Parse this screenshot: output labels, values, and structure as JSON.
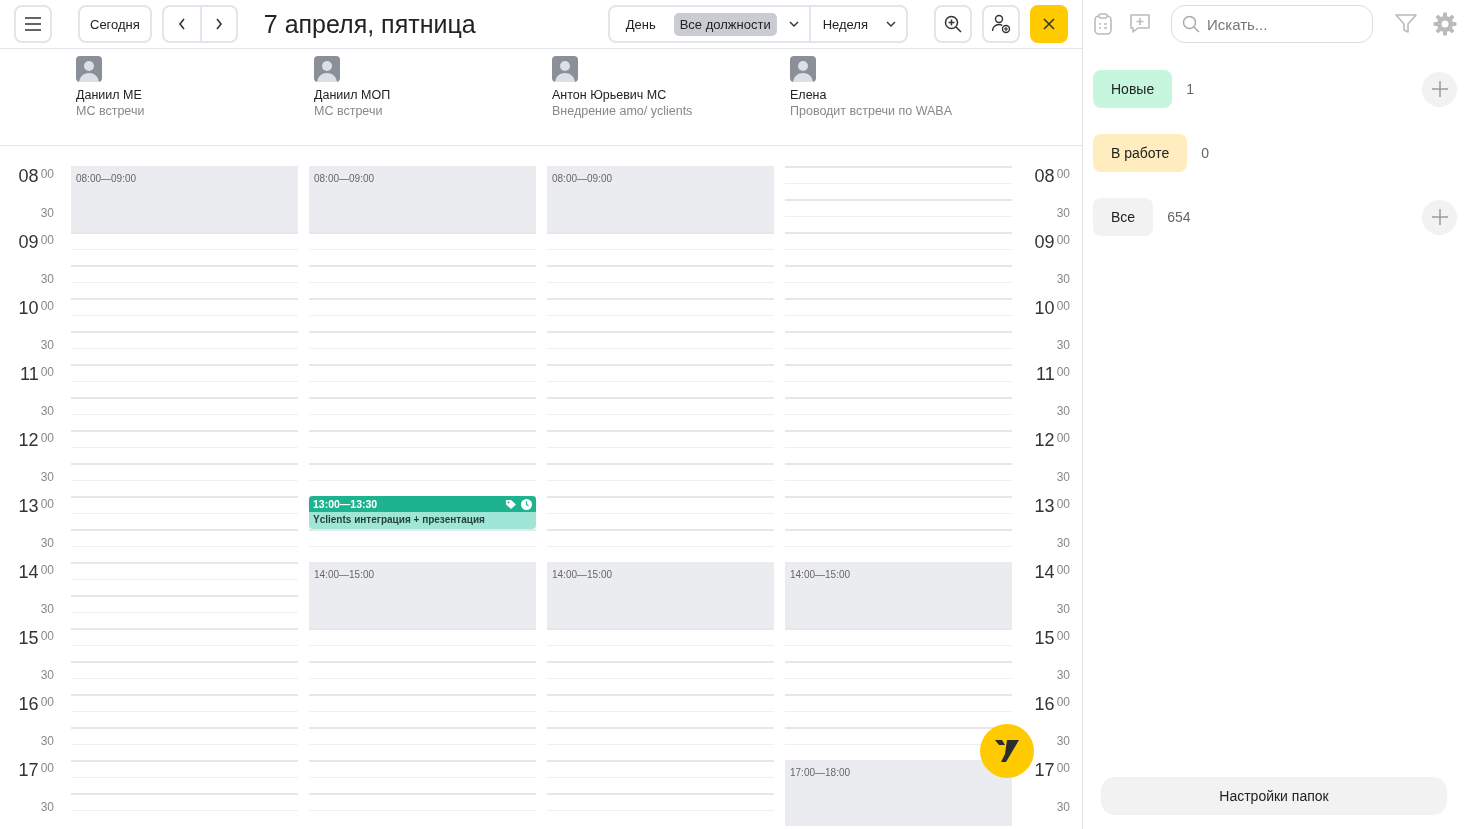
{
  "header": {
    "today_button": "Сегодня",
    "title": "7 апреля, пятница",
    "view_switcher": [
      {
        "label": "День",
        "selected": false,
        "dropdown": false
      },
      {
        "label": "Все должности",
        "selected": true,
        "dropdown": true
      },
      {
        "label": "Неделя",
        "selected": false,
        "dropdown": true
      }
    ]
  },
  "employees": [
    {
      "name": "Даниил МЕ",
      "role": "МС встречи",
      "events": [
        {
          "kind": "busy",
          "time": "08:00—09:00"
        }
      ]
    },
    {
      "name": "Даниил МОП",
      "role": "МС встречи",
      "events": [
        {
          "kind": "busy",
          "time": "08:00—09:00"
        },
        {
          "kind": "meeting",
          "time": "13:00—13:30",
          "title": "Yclients интеграция + презентация"
        },
        {
          "kind": "busy",
          "time": "14:00—15:00"
        }
      ]
    },
    {
      "name": "Антон Юрьевич МС",
      "role": "Внедрение amo/ yclients",
      "events": [
        {
          "kind": "busy",
          "time": "08:00—09:00"
        },
        {
          "kind": "busy",
          "time": "14:00—15:00"
        }
      ]
    },
    {
      "name": "Елена",
      "role": "Проводит встречи по WABA",
      "events": [
        {
          "kind": "busy",
          "time": "14:00—15:00"
        },
        {
          "kind": "busy",
          "time": "17:00—18:00"
        }
      ]
    }
  ],
  "time_axis_left": [
    {
      "hour": "08",
      "minutes": "00",
      "half": "30"
    },
    {
      "hour": "09",
      "minutes": "00",
      "half": "30"
    },
    {
      "hour": "10",
      "minutes": "00",
      "half": "30"
    },
    {
      "hour": "11",
      "minutes": "00",
      "half": "30"
    },
    {
      "hour": "12",
      "minutes": "00",
      "half": "30"
    },
    {
      "hour": "13",
      "minutes": "00",
      "half": "30"
    },
    {
      "hour": "14",
      "minutes": "00",
      "half": "30"
    },
    {
      "hour": "15",
      "minutes": "00",
      "half": "30"
    },
    {
      "hour": "16",
      "minutes": "00",
      "half": "30"
    },
    {
      "hour": "17",
      "minutes": "00",
      "half": "30"
    }
  ],
  "time_axis_right": [
    {
      "hour": "08",
      "minutes": "00",
      "half": "30"
    },
    {
      "hour": "09",
      "minutes": "00",
      "half": "30"
    },
    {
      "hour": "10",
      "minutes": "00",
      "half": "30"
    },
    {
      "hour": "11",
      "minutes": "00",
      "half": "30"
    },
    {
      "hour": "12",
      "minutes": "00",
      "half": "30"
    },
    {
      "hour": "13",
      "minutes": "00",
      "half": "30"
    },
    {
      "hour": "14",
      "minutes": "00",
      "half": "30"
    },
    {
      "hour": "15",
      "minutes": "00",
      "half": "30"
    },
    {
      "hour": "16",
      "minutes": "00",
      "half": "30"
    },
    {
      "hour": "17",
      "minutes": "00",
      "half": "30"
    }
  ],
  "sidebar": {
    "search": {
      "placeholder": "Искать..."
    },
    "folders": [
      {
        "label": "Новые",
        "count": "1",
        "color": "#c6f7de",
        "add": true
      },
      {
        "label": "В работе",
        "count": "0",
        "color": "#ffecbf",
        "add": false
      },
      {
        "label": "Все",
        "count": "654",
        "color": "#f2f2f2",
        "add": true
      }
    ],
    "settings_button": "Настройки папок"
  }
}
